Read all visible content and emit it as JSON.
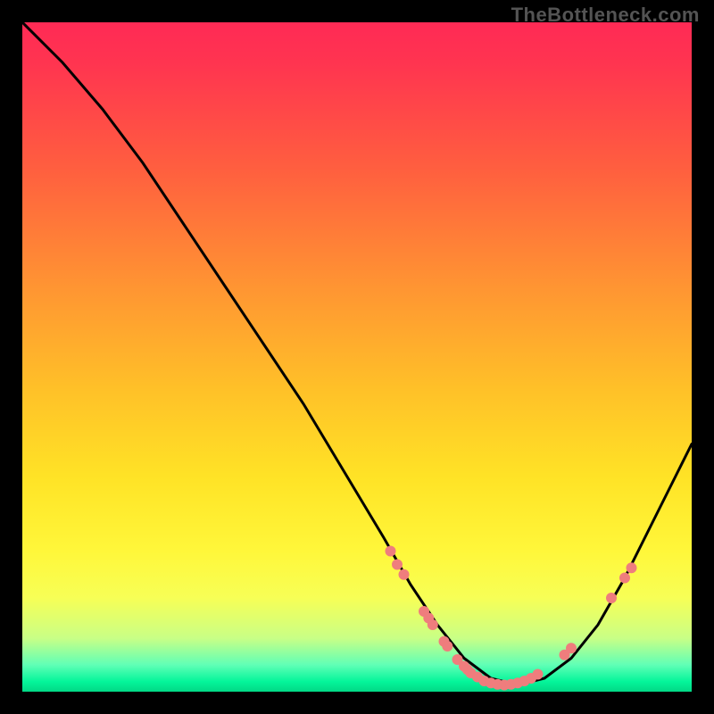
{
  "watermark": "TheBottleneck.com",
  "chart_data": {
    "type": "line",
    "title": "",
    "xlabel": "",
    "ylabel": "",
    "xlim": [
      0,
      100
    ],
    "ylim": [
      0,
      100
    ],
    "series": [
      {
        "name": "bottleneck-curve",
        "x": [
          0,
          6,
          12,
          18,
          24,
          30,
          36,
          42,
          48,
          54,
          58,
          62,
          66,
          70,
          74,
          78,
          82,
          86,
          90,
          94,
          98,
          100
        ],
        "y": [
          100,
          94,
          87,
          79,
          70,
          61,
          52,
          43,
          33,
          23,
          16,
          10,
          5,
          2,
          1,
          2,
          5,
          10,
          17,
          25,
          33,
          37
        ]
      }
    ],
    "markers": {
      "name": "highlighted-points",
      "color": "#ef7d7d",
      "points": [
        {
          "x": 55,
          "y": 21
        },
        {
          "x": 56,
          "y": 19
        },
        {
          "x": 57,
          "y": 17.5
        },
        {
          "x": 60,
          "y": 12
        },
        {
          "x": 60.7,
          "y": 11
        },
        {
          "x": 61.3,
          "y": 10
        },
        {
          "x": 63,
          "y": 7.5
        },
        {
          "x": 63.5,
          "y": 6.8
        },
        {
          "x": 65,
          "y": 4.8
        },
        {
          "x": 66,
          "y": 3.8
        },
        {
          "x": 66.5,
          "y": 3.3
        },
        {
          "x": 67,
          "y": 2.8
        },
        {
          "x": 68,
          "y": 2.2
        },
        {
          "x": 69,
          "y": 1.6
        },
        {
          "x": 70,
          "y": 1.3
        },
        {
          "x": 71,
          "y": 1.1
        },
        {
          "x": 72,
          "y": 1.0
        },
        {
          "x": 73,
          "y": 1.1
        },
        {
          "x": 74,
          "y": 1.3
        },
        {
          "x": 75,
          "y": 1.6
        },
        {
          "x": 76,
          "y": 2.0
        },
        {
          "x": 77,
          "y": 2.6
        },
        {
          "x": 81,
          "y": 5.5
        },
        {
          "x": 82,
          "y": 6.5
        },
        {
          "x": 88,
          "y": 14
        },
        {
          "x": 90,
          "y": 17
        },
        {
          "x": 91,
          "y": 18.5
        }
      ]
    },
    "gradient_stops": [
      {
        "pos": 0,
        "color": "#ff2a55"
      },
      {
        "pos": 0.5,
        "color": "#ffc128"
      },
      {
        "pos": 0.8,
        "color": "#fff73a"
      },
      {
        "pos": 1.0,
        "color": "#02d885"
      }
    ]
  }
}
